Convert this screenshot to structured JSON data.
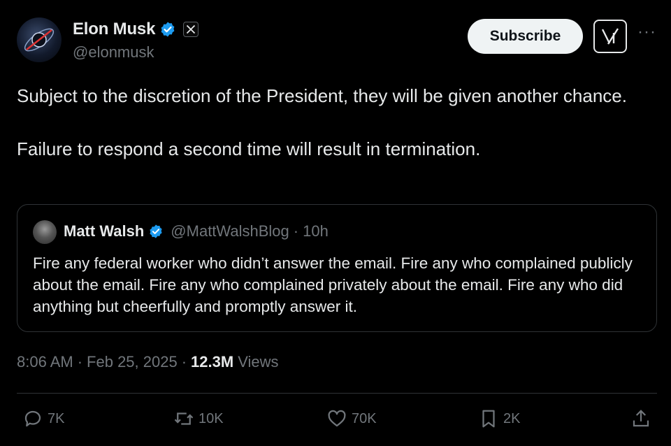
{
  "author": {
    "name": "Elon Musk",
    "handle": "@elonmusk"
  },
  "header": {
    "subscribe_label": "Subscribe",
    "more_label": "···"
  },
  "tweet": {
    "text": "Subject to the discretion of the President, they will be given another chance.\n\nFailure to respond a second time will result in termination."
  },
  "quote": {
    "name": "Matt Walsh",
    "handle": "@MattWalshBlog",
    "separator": "·",
    "time": "10h",
    "text": "Fire any federal worker who didn’t answer the email. Fire any who complained publicly about the email. Fire any who complained privately about the email. Fire any who did anything but cheerfully and promptly answer it."
  },
  "meta": {
    "time": "8:06 AM",
    "sep1": "·",
    "date": "Feb 25, 2025",
    "sep2": "·",
    "views_count": "12.3M",
    "views_label": "Views"
  },
  "actions": {
    "replies": "7K",
    "reposts": "10K",
    "likes": "70K",
    "bookmarks": "2K"
  },
  "icons": {
    "verified": "verified-badge-icon",
    "affiliate": "x-logo-icon",
    "grok": "grok-icon",
    "reply": "reply-icon",
    "repost": "repost-icon",
    "like": "heart-icon",
    "bookmark": "bookmark-icon",
    "share": "share-icon"
  },
  "colors": {
    "background": "#000000",
    "text": "#e7e9ea",
    "secondary": "#71767b",
    "verified": "#1d9bf0",
    "border": "#2f3336"
  }
}
